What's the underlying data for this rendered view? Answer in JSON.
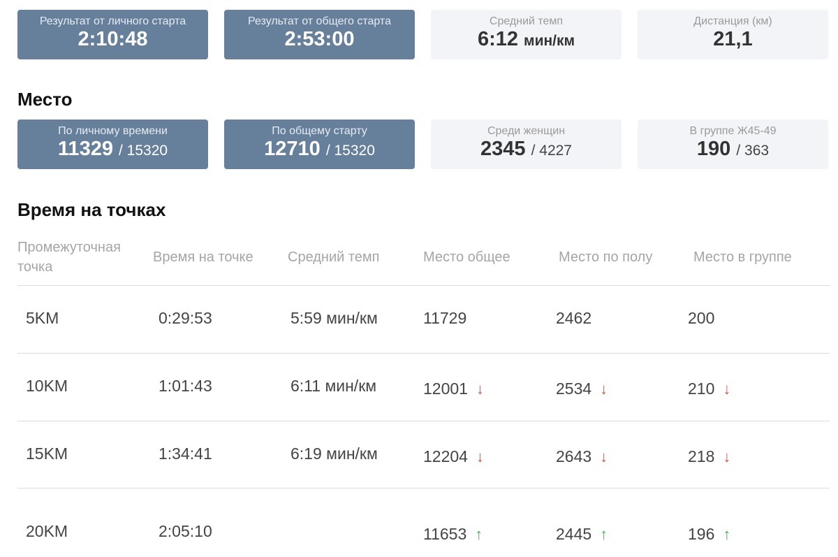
{
  "result_cards": [
    {
      "label": "Результат от личного старта",
      "value": "2:10:48",
      "style": "dark"
    },
    {
      "label": "Результат от общего старта",
      "value": "2:53:00",
      "style": "dark"
    },
    {
      "label": "Средний темп",
      "value": "6:12",
      "unit": "мин/км",
      "style": "light"
    },
    {
      "label": "Дистанция (км)",
      "value": "21,1",
      "style": "light"
    }
  ],
  "place_heading": "Место",
  "place_cards": [
    {
      "label": "По личному времени",
      "value": "11329",
      "total": "/ 15320",
      "style": "dark"
    },
    {
      "label": "По общему старту",
      "value": "12710",
      "total": "/ 15320",
      "style": "dark"
    },
    {
      "label": "Среди женщин",
      "value": "2345",
      "total": "/ 4227",
      "style": "light"
    },
    {
      "label": "В группе Ж45-49",
      "value": "190",
      "total": "/ 363",
      "style": "light"
    }
  ],
  "points_heading": "Время на точках",
  "table": {
    "headers": [
      "Промежуточная точка",
      "Время на точке",
      "Средний темп",
      "Место общее",
      "Место по полу",
      "Место в группе"
    ],
    "rows": [
      {
        "point": "5KM",
        "time": "0:29:53",
        "pace": "5:59 мин/км",
        "overall": "11729",
        "gender": "2462",
        "group": "200",
        "trend": "none"
      },
      {
        "point": "10KM",
        "time": "1:01:43",
        "pace": "6:11 мин/км",
        "overall": "12001",
        "gender": "2534",
        "group": "210",
        "trend": "down"
      },
      {
        "point": "15KM",
        "time": "1:34:41",
        "pace": "6:19 мин/км",
        "overall": "12204",
        "gender": "2643",
        "group": "218",
        "trend": "down"
      },
      {
        "point": "20KM",
        "time": "2:05:10",
        "pace": "",
        "overall": "11653",
        "gender": "2445",
        "group": "196",
        "trend": "up"
      }
    ]
  },
  "colors": {
    "dark_card": "#66809c",
    "light_card": "#f3f4f7",
    "down_arrow": "#d9534f",
    "up_arrow": "#4caf50"
  }
}
